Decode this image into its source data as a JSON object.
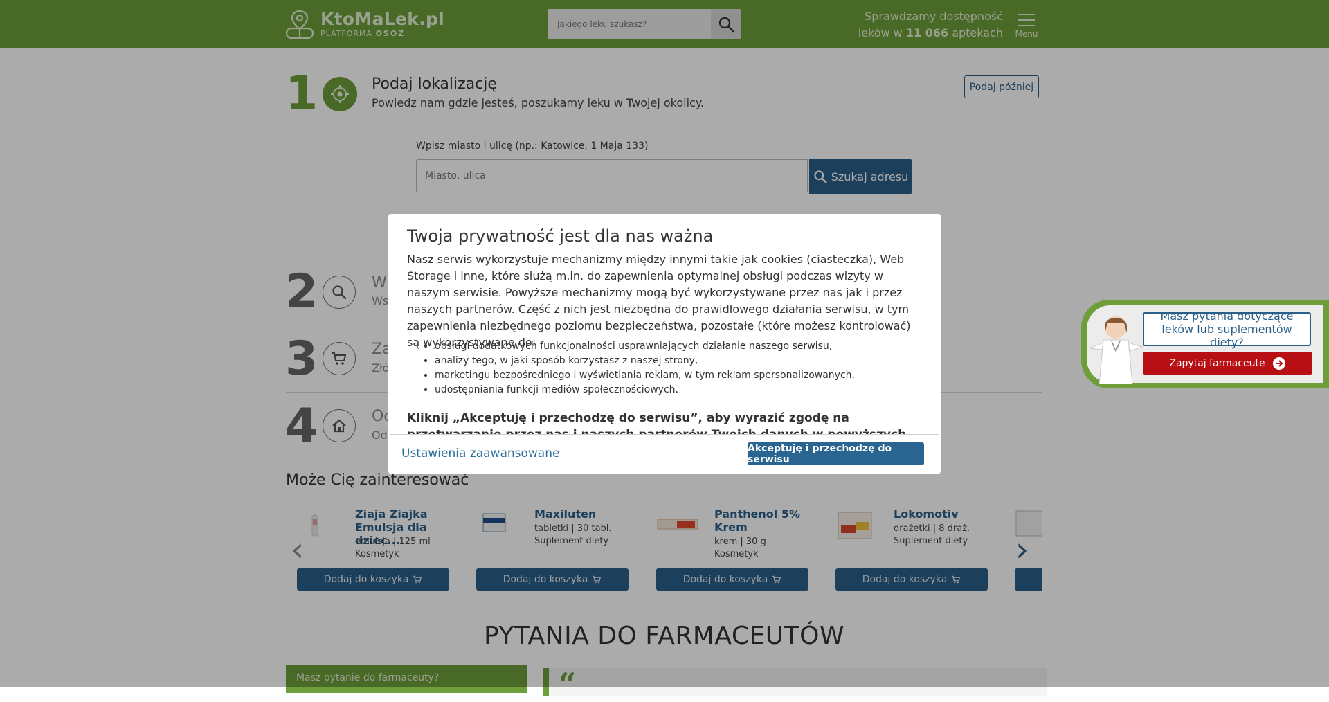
{
  "header": {
    "logo_main": "KtoMaLek.pl",
    "logo_sub_prefix": "PLATFORMA",
    "logo_sub_brand": "OSOZ",
    "search_placeholder": "Jakiego leku szukasz?",
    "availability_line1": "Sprawdzamy dostępność",
    "availability_prefix": "leków w",
    "availability_count": "11 066",
    "availability_suffix": "aptekach",
    "menu_label": "Menu"
  },
  "steps": [
    {
      "number": "1",
      "title": "Podaj lokalizację",
      "subtitle": "Powiedz nam gdzie jesteś, poszukamy leku w Twojej okolicy.",
      "icon": "locate-icon"
    },
    {
      "number": "2",
      "title": "Ws",
      "subtitle": "Ws",
      "icon": "search-icon"
    },
    {
      "number": "3",
      "title": "Za",
      "subtitle": "Złó",
      "icon": "cart-icon"
    },
    {
      "number": "4",
      "title": "Od",
      "subtitle": "Od",
      "icon": "home-icon"
    }
  ],
  "location": {
    "later_button": "Podaj później",
    "address_label": "Wpisz miasto i ulicę (np.: Katowice, 1 Maja 133)",
    "address_placeholder": "Miasto, ulica",
    "search_button": "Szukaj adresu"
  },
  "interest": {
    "title": "Może Cię zainteresować",
    "add_to_cart": "Dodaj do koszyka",
    "products": [
      {
        "name": "Ziaja Ziajka Emulsja dla dziec...",
        "line1": "emulsja | 125 ml",
        "line2": "Kosmetyk"
      },
      {
        "name": "Maxiluten",
        "line1": "tabletki | 30 tabl.",
        "line2": "Suplement diety"
      },
      {
        "name": "Panthenol 5% Krem",
        "line1": "krem | 30 g",
        "line2": "Kosmetyk"
      },
      {
        "name": "Lokomotiv",
        "line1": "drażetki | 8 draż.",
        "line2": "Suplement diety"
      }
    ]
  },
  "questions": {
    "heading": "PYTANIA DO FARMACEUTÓW",
    "ask_label": "Masz pytanie do farmaceuty?"
  },
  "widget": {
    "question": "Masz pytania dotyczące leków lub suplementów diety?",
    "button": "Zapytaj farmaceutę"
  },
  "modal": {
    "title": "Twoja prywatność jest dla nas ważna",
    "body": "Nasz serwis wykorzystuje mechanizmy między innymi takie jak cookies (ciasteczka), Web Storage i inne, które służą m.in. do zapewnienia optymalnej obsługi podczas wizyty w naszym serwisie. Powyższe mechanizmy mogą być wykorzystywane przez nas jak i przez naszych partnerów. Część z nich jest niezbędna do prawidłowego działania serwisu, w tym zapewnienia niezbędnego poziomu bezpieczeństwa, pozostałe (które możesz kontrolować) są wykorzystywane do:",
    "list": [
      "obsługi dodatkowych funkcjonalności usprawniających działanie naszego serwisu,",
      "analizy tego, w jaki sposób korzystasz z naszej strony,",
      "marketingu bezpośredniego i wyświetlania reklam, w tym reklam spersonalizowanych,",
      "udostępniania funkcji mediów społecznościowych."
    ],
    "bold_text": "Kliknij „Akceptuję i przechodzę do serwisu”, aby wyrazić zgodę na przetwarzanie przez nas i naszych partnerów Twoich danych w powyższych celach.",
    "advanced_link": "Ustawienia zaawansowane",
    "accept_button": "Akceptuję i przechodzę do serwisu"
  },
  "colors": {
    "brand_green": "#6d9e3a",
    "link_blue": "#2a5f88",
    "cta_red": "#b70f14"
  }
}
